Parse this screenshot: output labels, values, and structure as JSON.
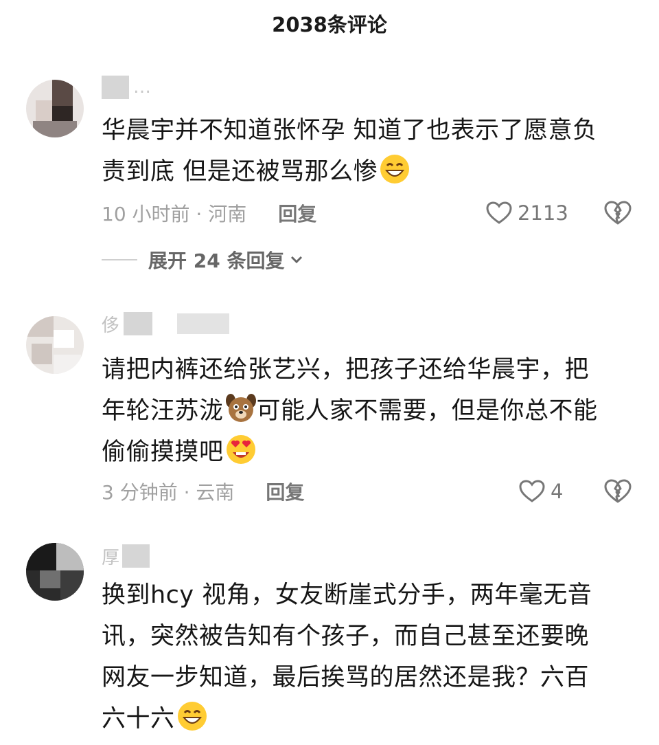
{
  "header": {
    "title": "2038条评论"
  },
  "comments": [
    {
      "username_visible": "…",
      "text_line1": "华晨宇并不知道张怀孕 知道了也表示了愿意负",
      "text_line2": "责到底 但是还被骂那么惨",
      "emoji": "grinning-face",
      "time_location": "10 小时前 · 河南",
      "reply_label": "回复",
      "likes": "2113",
      "expand_label": "展开 24 条回复"
    },
    {
      "username_visible": "侈",
      "text_line1": "请把内裤还给张艺兴，把孩子还给华晨宇，把",
      "text_line2_a": "年轮汪苏泷",
      "text_line2_b": "可能人家不需要，但是你总不能",
      "text_line3": "偷偷摸摸吧",
      "emojis": [
        "dog-face",
        "heart-eyes-face"
      ],
      "time_location": "3 分钟前 · 云南",
      "reply_label": "回复",
      "likes": "4"
    },
    {
      "username_visible": "厚",
      "text_line1": "换到hcy 视角，女友断崖式分手，两年毫无音",
      "text_line2": "讯，突然被告知有个孩子，而自己甚至还要晚",
      "text_line3": "网友一步知道，最后挨骂的居然还是我？六百",
      "text_line4": "六十六",
      "emoji": "grinning-face"
    }
  ],
  "colors": {
    "text": "#161616",
    "meta": "#a0a0a0",
    "icon": "#777777"
  }
}
